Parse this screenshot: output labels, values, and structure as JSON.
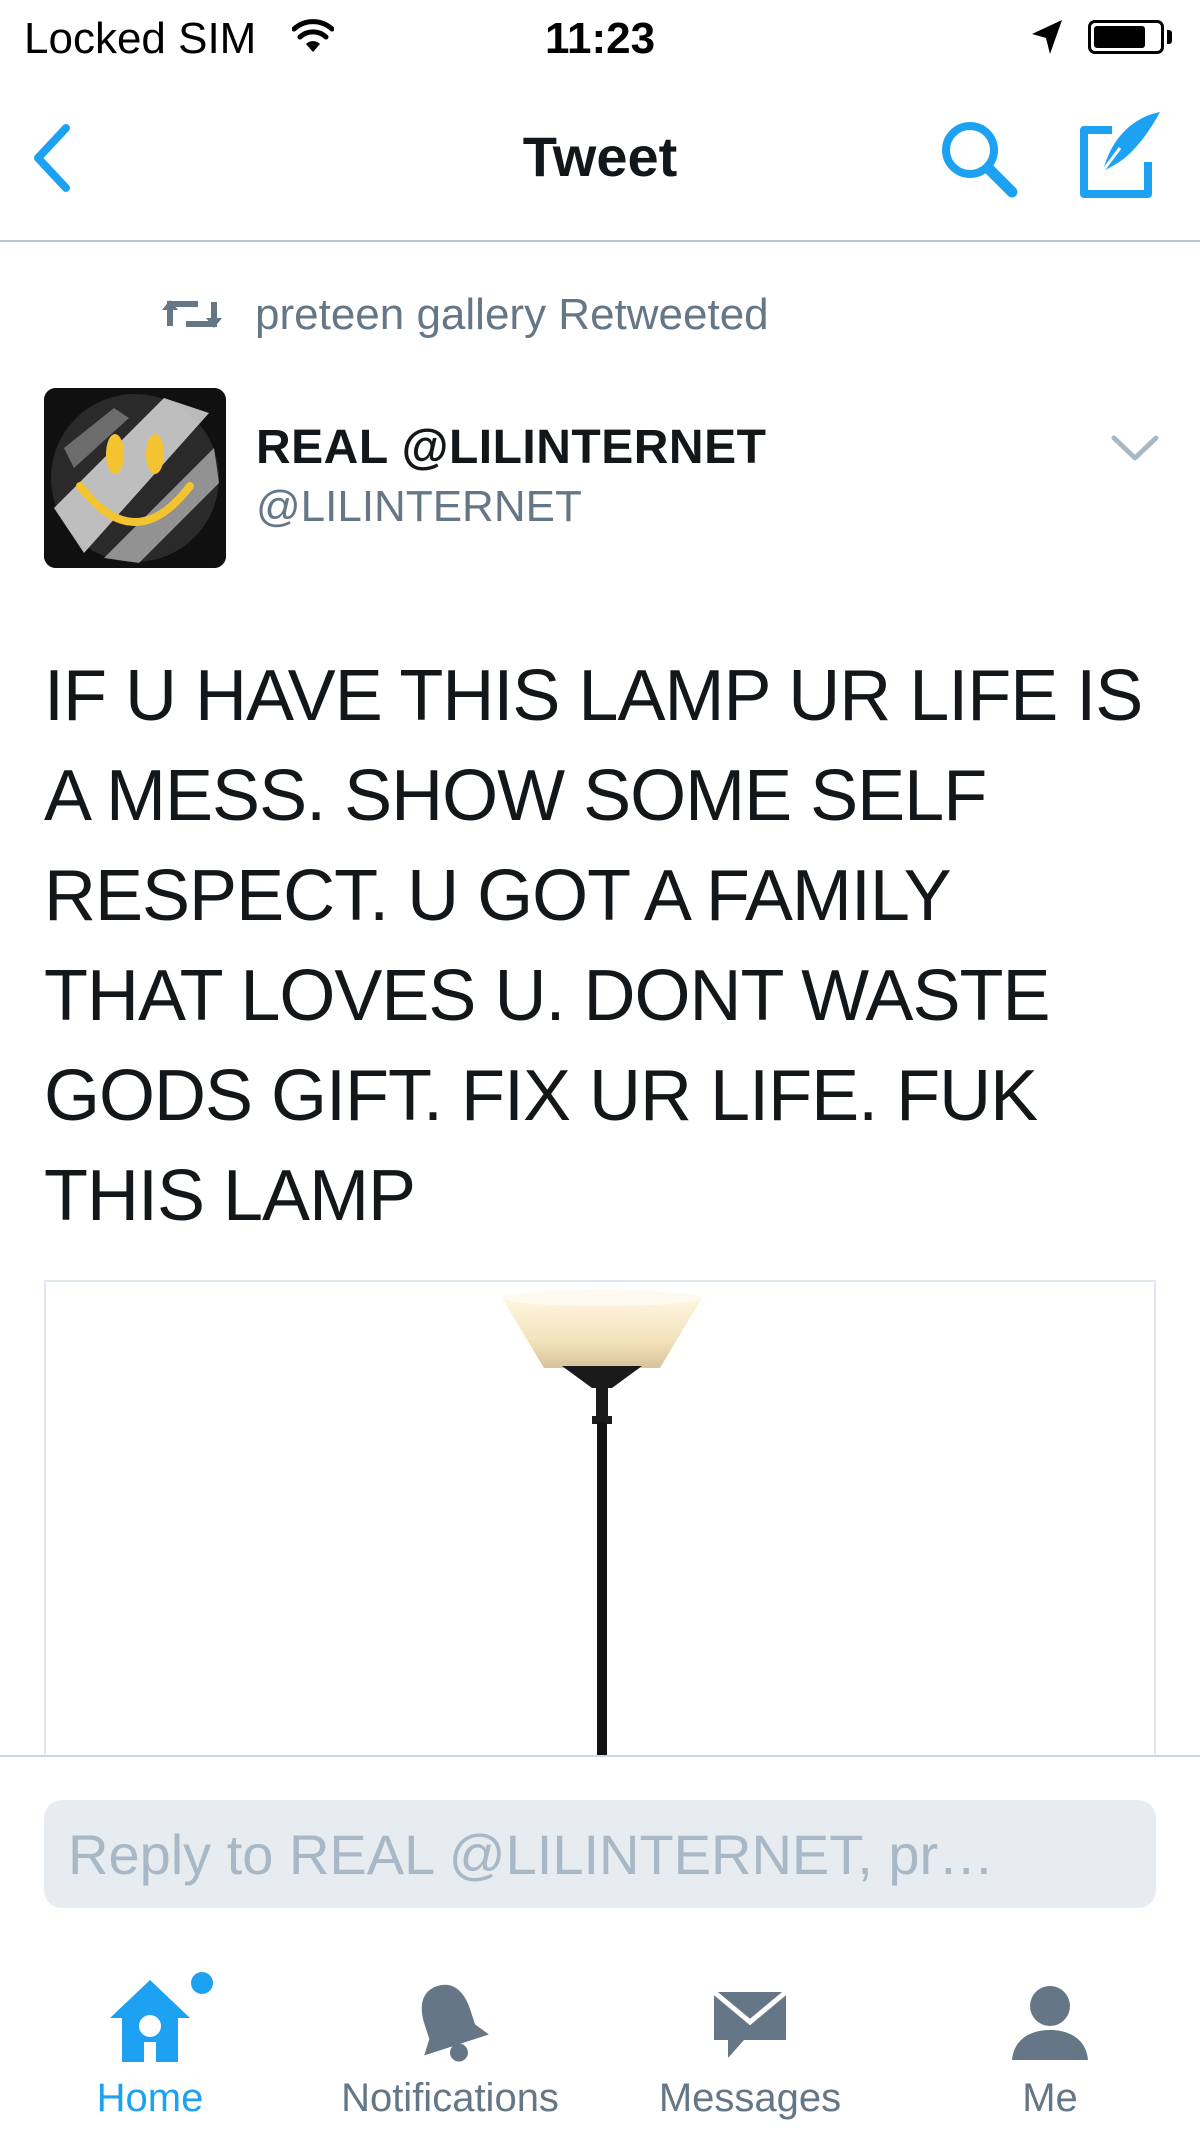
{
  "status_bar": {
    "carrier": "Locked SIM",
    "time": "11:23",
    "battery_level": 0.8
  },
  "nav": {
    "title": "Tweet",
    "back_icon": "chevron-left-icon",
    "search_icon": "search-icon",
    "compose_icon": "compose-icon"
  },
  "retweet_context": {
    "icon": "retweet-icon",
    "text": "preteen gallery Retweeted"
  },
  "tweet": {
    "display_name": "REAL @LILINTERNET",
    "handle": "@LILINTERNET",
    "text": "IF U HAVE THIS LAMP UR LIFE IS\nA MESS. SHOW SOME SELF\nRESPECT. U GOT A FAMILY\nTHAT LOVES U. DONT WASTE\nGODS GIFT. FIX UR LIFE. FUK\nTHIS LAMP",
    "media_subject": "floor lamp"
  },
  "reply": {
    "placeholder": "Reply to REAL @LILINTERNET, pr…"
  },
  "tab_bar": {
    "tabs": [
      {
        "label": "Home",
        "icon": "home-icon",
        "active": true,
        "has_dot": true
      },
      {
        "label": "Notifications",
        "icon": "bell-icon",
        "active": false
      },
      {
        "label": "Messages",
        "icon": "envelope-icon",
        "active": false
      },
      {
        "label": "Me",
        "icon": "person-icon",
        "active": false
      }
    ]
  },
  "colors": {
    "accent": "#1da1f2",
    "secondary_text": "#657786",
    "primary_text": "#14171a",
    "input_bg": "#e6ecf0"
  }
}
